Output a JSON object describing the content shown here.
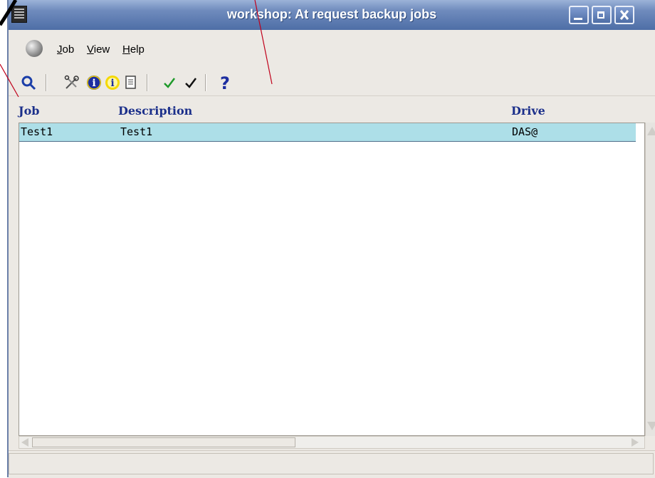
{
  "window": {
    "title": "workshop: At request backup jobs"
  },
  "menu": {
    "job": "Job",
    "view": "View",
    "help": "Help"
  },
  "toolbar": {
    "icons": [
      "search-icon",
      "tools-icon",
      "info-filled-icon",
      "info-outline-icon",
      "document-icon",
      "check-green-icon",
      "check-black-icon",
      "help-question-icon"
    ]
  },
  "table": {
    "columns": {
      "job": "Job",
      "description": "Description",
      "drive": "Drive"
    },
    "rows": [
      {
        "job": "Test1",
        "description": "Test1",
        "drive": "DAS@"
      }
    ]
  },
  "colors": {
    "title_gradient_top": "#9cb3d8",
    "title_gradient_bottom": "#4e6ea6",
    "header_text": "#1b2f8a",
    "selected_row": "#addfe8",
    "annotation_line": "#c0001a"
  }
}
